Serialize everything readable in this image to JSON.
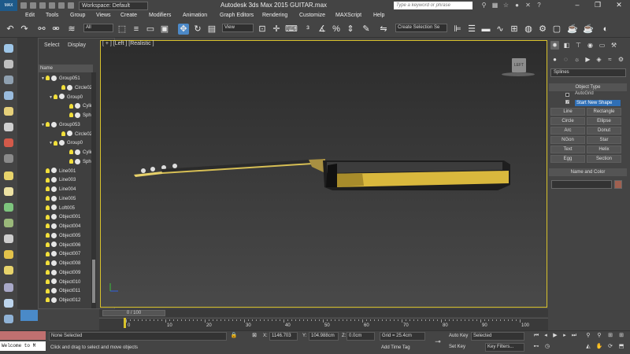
{
  "app": {
    "logo_label": "MAX",
    "workspace_label": "Workspace: Default",
    "title": "Autodesk 3ds Max  2015      GUITAR.max",
    "search_placeholder": "Type a keyword or phrase"
  },
  "menu": [
    "Edit",
    "Tools",
    "Group",
    "Views",
    "Create",
    "Modifiers",
    "Animation",
    "Graph Editors",
    "Rendering",
    "Customize",
    "MAXScript",
    "Help"
  ],
  "toolbar": {
    "filter_value": "All",
    "coord_system": "View",
    "selection_set": "Create Selection Se"
  },
  "explorer": {
    "tabs": [
      "Select",
      "Display"
    ],
    "column_header": "Name",
    "rows": [
      {
        "label": "Group051",
        "level": 0,
        "kind": "group",
        "expand": "▼"
      },
      {
        "label": "Circle02",
        "level": 2,
        "kind": "obj",
        "expand": ""
      },
      {
        "label": "Group0",
        "level": 1,
        "kind": "group",
        "expand": "▼"
      },
      {
        "label": "Cylin",
        "level": 3,
        "kind": "obj",
        "expand": ""
      },
      {
        "label": "Sphe",
        "level": 3,
        "kind": "obj",
        "expand": ""
      },
      {
        "label": "Group053",
        "level": 0,
        "kind": "group",
        "expand": "▼"
      },
      {
        "label": "Circle02",
        "level": 2,
        "kind": "obj",
        "expand": ""
      },
      {
        "label": "Group0",
        "level": 1,
        "kind": "group",
        "expand": "▼"
      },
      {
        "label": "Cylin",
        "level": 3,
        "kind": "obj",
        "expand": ""
      },
      {
        "label": "Sphe",
        "level": 3,
        "kind": "obj",
        "expand": ""
      },
      {
        "label": "Line001",
        "level": 0,
        "kind": "obj",
        "expand": ""
      },
      {
        "label": "Line003",
        "level": 0,
        "kind": "obj",
        "expand": ""
      },
      {
        "label": "Line004",
        "level": 0,
        "kind": "obj",
        "expand": ""
      },
      {
        "label": "Line005",
        "level": 0,
        "kind": "obj",
        "expand": ""
      },
      {
        "label": "Loft005",
        "level": 0,
        "kind": "obj",
        "expand": ""
      },
      {
        "label": "Object001",
        "level": 0,
        "kind": "obj",
        "expand": ""
      },
      {
        "label": "Object004",
        "level": 0,
        "kind": "obj",
        "expand": ""
      },
      {
        "label": "Object005",
        "level": 0,
        "kind": "obj",
        "expand": ""
      },
      {
        "label": "Object006",
        "level": 0,
        "kind": "obj",
        "expand": ""
      },
      {
        "label": "Object007",
        "level": 0,
        "kind": "obj",
        "expand": ""
      },
      {
        "label": "Object008",
        "level": 0,
        "kind": "obj",
        "expand": ""
      },
      {
        "label": "Object009",
        "level": 0,
        "kind": "obj",
        "expand": ""
      },
      {
        "label": "Object010",
        "level": 0,
        "kind": "obj",
        "expand": ""
      },
      {
        "label": "Object011",
        "level": 0,
        "kind": "obj",
        "expand": ""
      },
      {
        "label": "Object012",
        "level": 0,
        "kind": "obj",
        "expand": ""
      }
    ]
  },
  "viewport": {
    "label": "[ + ] [Left ] [Realistic ]",
    "viewcube_label": "LEFT"
  },
  "command_panel": {
    "category_dropdown": "Splines",
    "object_type_title": "Object Type",
    "autogrid_label": "AutoGrid",
    "start_new_shape_label": "Start New Shape",
    "buttons": [
      "Line",
      "Rectangle",
      "Circle",
      "Ellipse",
      "Arc",
      "Donut",
      "NGon",
      "Star",
      "Text",
      "Helix",
      "Egg",
      "Section"
    ],
    "name_color_title": "Name and Color"
  },
  "timeline": {
    "slider_label": "0 / 100",
    "ticks": [
      "0",
      "10",
      "20",
      "30",
      "40",
      "50",
      "60",
      "70",
      "80",
      "90",
      "100"
    ]
  },
  "status": {
    "maxscript_listener_text": "Welcome to M",
    "selection_status": "None Selected",
    "prompt": "Click and drag to select and move objects",
    "x_label": "X:",
    "x_value": "1146.703",
    "y_label": "Y:",
    "y_value": "104.988cm",
    "z_label": "Z:",
    "z_value": "0.0cm",
    "grid": "Grid = 25.4cm",
    "add_time_tag": "Add Time Tag",
    "auto_key": "Auto Key",
    "selected_dropdown": "Selected",
    "set_key": "Set Key",
    "key_filters": "Key Filters..."
  }
}
